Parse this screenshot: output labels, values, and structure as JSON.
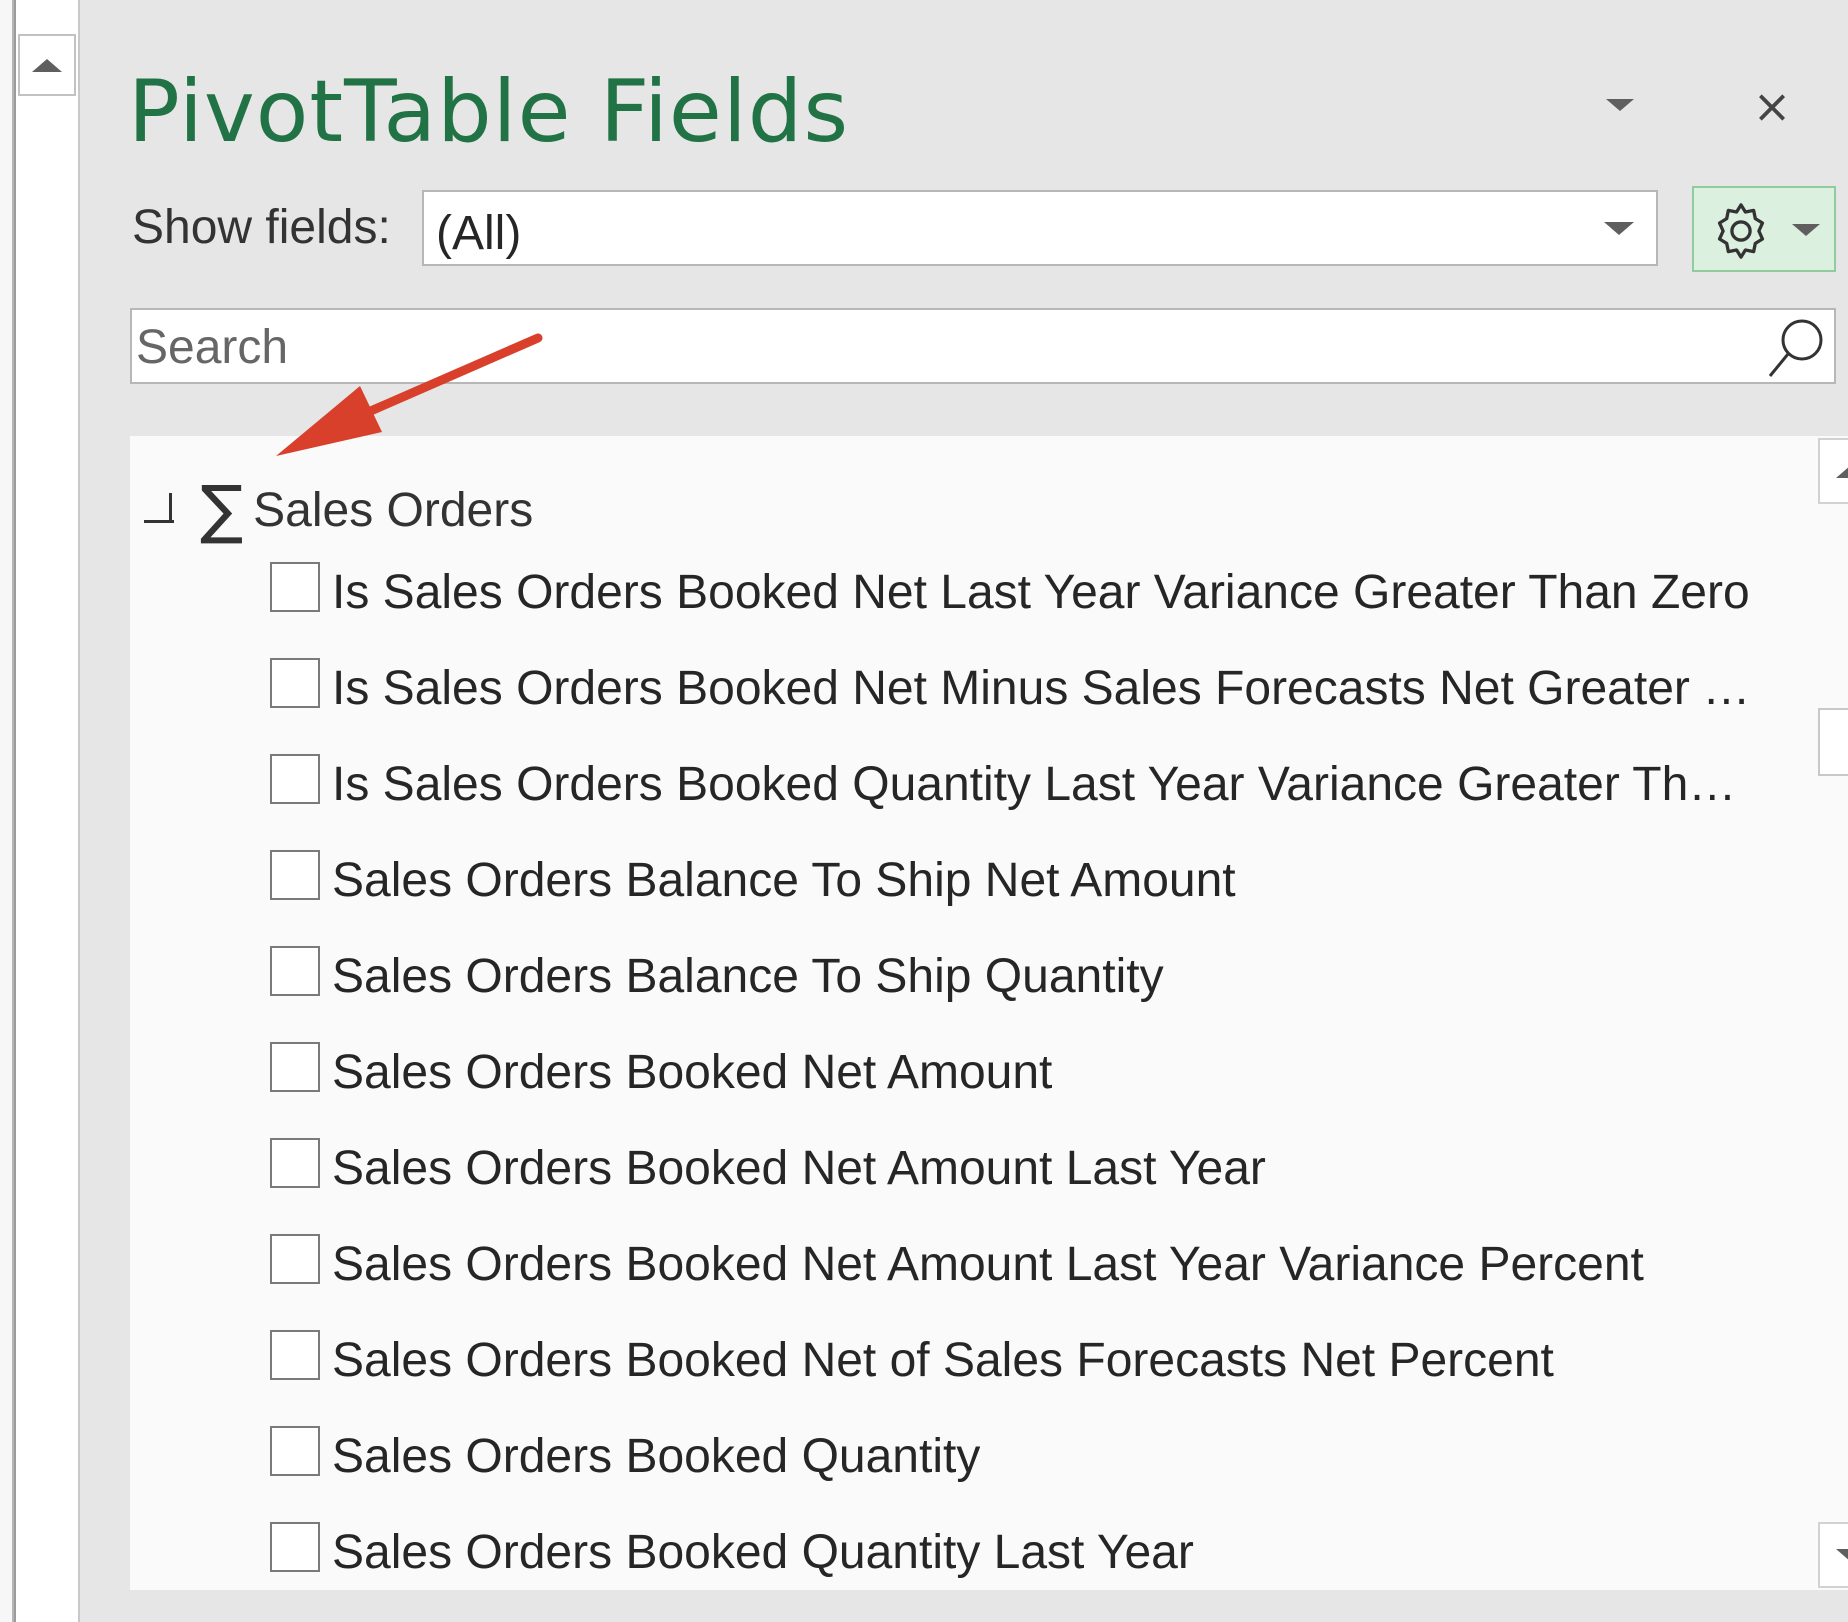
{
  "pane": {
    "title": "PivotTable Fields",
    "close_glyph": "×",
    "menu_icon": "chevron-down-icon"
  },
  "show_fields": {
    "label": "Show fields:",
    "value": "(All)"
  },
  "settings_button": {
    "icon": "gear-icon"
  },
  "search": {
    "placeholder": "Search",
    "icon": "search-icon"
  },
  "field_list": {
    "group": {
      "name": "Sales Orders",
      "icon": "sigma-icon",
      "expanded": true
    },
    "items": [
      {
        "label": "Is Sales Orders Booked Net Last Year Variance Greater Than Zero",
        "checked": false
      },
      {
        "label": "Is Sales Orders Booked Net Minus Sales Forecasts Net Greater Th...",
        "checked": false
      },
      {
        "label": "Is Sales Orders Booked Quantity Last Year Variance Greater Than ...",
        "checked": false
      },
      {
        "label": "Sales Orders Balance To Ship Net Amount",
        "checked": false
      },
      {
        "label": "Sales Orders Balance To Ship Quantity",
        "checked": false
      },
      {
        "label": "Sales Orders Booked Net Amount",
        "checked": false
      },
      {
        "label": "Sales Orders Booked Net Amount Last Year",
        "checked": false
      },
      {
        "label": "Sales Orders Booked Net Amount Last Year Variance Percent",
        "checked": false
      },
      {
        "label": "Sales Orders Booked Net of Sales Forecasts Net Percent",
        "checked": false
      },
      {
        "label": "Sales Orders Booked Quantity",
        "checked": false
      },
      {
        "label": "Sales Orders Booked Quantity Last Year",
        "checked": false
      }
    ]
  },
  "colors": {
    "title": "#217346",
    "annotation_arrow": "#d9402b",
    "settings_bg": "#dbf0df"
  }
}
